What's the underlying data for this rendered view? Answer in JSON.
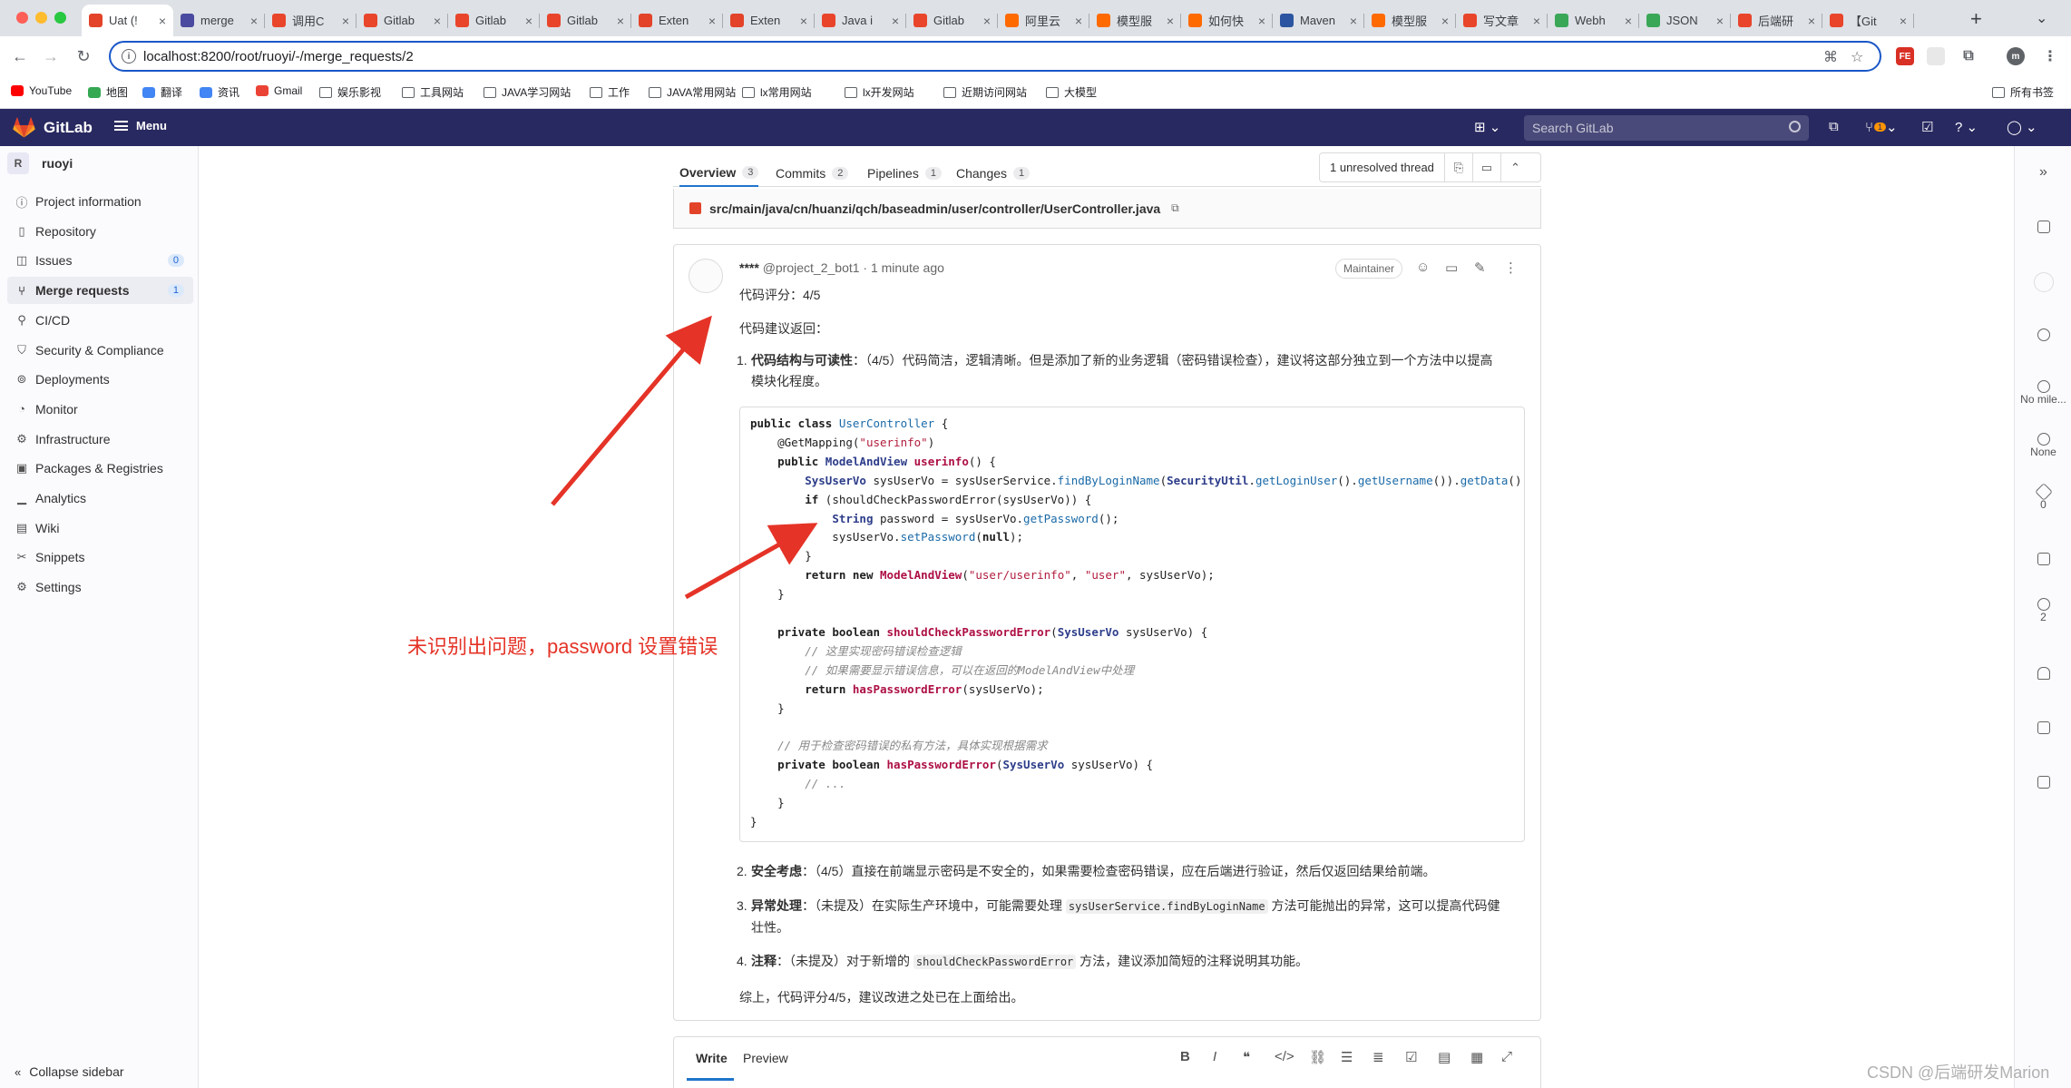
{
  "browser": {
    "tabs": [
      {
        "label": "Uat (!",
        "color": "#e24329",
        "icon": "gitlab-icon",
        "active": true
      },
      {
        "label": "merge",
        "color": "#4a4aa0",
        "icon": "web-icon"
      },
      {
        "label": "调用C",
        "color": "#e8452b",
        "icon": "csdn-icon"
      },
      {
        "label": "Gitlab",
        "color": "#e8452b",
        "icon": "csdn-icon"
      },
      {
        "label": "Gitlab",
        "color": "#e8452b",
        "icon": "csdn-icon"
      },
      {
        "label": "Gitlab",
        "color": "#e8452b",
        "icon": "csdn-icon"
      },
      {
        "label": "Exten",
        "color": "#e24329",
        "icon": "gitlab-icon"
      },
      {
        "label": "Exten",
        "color": "#e24329",
        "icon": "gitlab-icon"
      },
      {
        "label": "Java i",
        "color": "#e8452b",
        "icon": "csdn-icon"
      },
      {
        "label": "Gitlab",
        "color": "#e8452b",
        "icon": "csdn-icon"
      },
      {
        "label": "阿里云",
        "color": "#ff6a00",
        "icon": "aliyun-icon"
      },
      {
        "label": "模型服",
        "color": "#ff6a00",
        "icon": "aliyun-icon"
      },
      {
        "label": "如何快",
        "color": "#ff6a00",
        "icon": "aliyun-icon"
      },
      {
        "label": "Maven",
        "color": "#2b55a0",
        "icon": "maven-icon"
      },
      {
        "label": "模型服",
        "color": "#ff6a00",
        "icon": "aliyun-icon"
      },
      {
        "label": "写文章",
        "color": "#e8452b",
        "icon": "csdn-icon"
      },
      {
        "label": "Webh",
        "color": "#3aa757",
        "icon": "webhook-icon"
      },
      {
        "label": "JSON",
        "color": "#3aa757",
        "icon": "json-icon"
      },
      {
        "label": "后端研",
        "color": "#e8452b",
        "icon": "csdn-icon"
      },
      {
        "label": "【Git",
        "color": "#e8452b",
        "icon": "csdn-icon"
      }
    ],
    "url": "localhost:8200/root/ruoyi/-/merge_requests/2",
    "bookmarks": [
      {
        "label": "YouTube",
        "icon": "youtube-icon"
      },
      {
        "label": "地图",
        "icon": "maps-icon"
      },
      {
        "label": "翻译",
        "icon": "translate-icon"
      },
      {
        "label": "资讯",
        "icon": "news-icon"
      },
      {
        "label": "Gmail",
        "icon": "gmail-icon"
      },
      {
        "label": "娱乐影视",
        "icon": "folder-icon"
      },
      {
        "label": "工具网站",
        "icon": "folder-icon"
      },
      {
        "label": "JAVA学习网站",
        "icon": "folder-icon"
      },
      {
        "label": "工作",
        "icon": "folder-icon"
      },
      {
        "label": "JAVA常用网站",
        "icon": "folder-icon"
      },
      {
        "label": "lx常用网站",
        "icon": "folder-icon"
      },
      {
        "label": "lx开发网站",
        "icon": "folder-icon"
      },
      {
        "label": "近期访问网站",
        "icon": "folder-icon"
      },
      {
        "label": "大模型",
        "icon": "folder-icon"
      }
    ],
    "all_bookmarks": "所有书签"
  },
  "gitlab": {
    "brand": "GitLab",
    "menu": "Menu",
    "search_placeholder": "Search GitLab",
    "mr_badge": "1"
  },
  "sidebar": {
    "project_initial": "R",
    "project_name": "ruoyi",
    "items": [
      {
        "label": "Project information",
        "icon": "info-icon"
      },
      {
        "label": "Repository",
        "icon": "doc-icon"
      },
      {
        "label": "Issues",
        "icon": "issues-icon",
        "count": "0"
      },
      {
        "label": "Merge requests",
        "icon": "merge-request-icon",
        "count": "1",
        "active": true
      },
      {
        "label": "CI/CD",
        "icon": "rocket-icon"
      },
      {
        "label": "Security & Compliance",
        "icon": "shield-icon"
      },
      {
        "label": "Deployments",
        "icon": "deployments-icon"
      },
      {
        "label": "Monitor",
        "icon": "monitor-icon"
      },
      {
        "label": "Infrastructure",
        "icon": "infrastructure-icon"
      },
      {
        "label": "Packages & Registries",
        "icon": "package-icon"
      },
      {
        "label": "Analytics",
        "icon": "chart-icon"
      },
      {
        "label": "Wiki",
        "icon": "book-icon"
      },
      {
        "label": "Snippets",
        "icon": "snippet-icon"
      },
      {
        "label": "Settings",
        "icon": "gear-icon"
      }
    ],
    "collapse": "Collapse sidebar"
  },
  "mr": {
    "tabs": [
      {
        "label": "Overview",
        "count": "3",
        "active": true
      },
      {
        "label": "Commits",
        "count": "2"
      },
      {
        "label": "Pipelines",
        "count": "1"
      },
      {
        "label": "Changes",
        "count": "1"
      }
    ],
    "unresolved": "1 unresolved thread",
    "file_path": "src/main/java/cn/huanzi/qch/baseadmin/user/controller/UserController.java"
  },
  "note": {
    "author": "****",
    "handle": "@project_2_bot1 · 1 minute ago",
    "role": "Maintainer",
    "score": "代码评分：4/5",
    "intro": "代码建议返回：",
    "item1_title": "代码结构与可读性",
    "item1_text": "：（4/5）代码简洁，逻辑清晰。但是添加了新的业务逻辑（密码错误检查），建议将这部分独立到一个方法中以提高",
    "item1_text2": "模块化程度。",
    "item2_title": "安全考虑",
    "item2_text": "：（4/5）直接在前端显示密码是不安全的，如果需要检查密码错误，应在后端进行验证，然后仅返回结果给前端。",
    "item3_title": "异常处理",
    "item3_pre": "：（未提及）在实际生产环境中，可能需要处理 ",
    "item3_code": "sysUserService.findByLoginName",
    "item3_post": " 方法可能抛出的异常，这可以提高代码健",
    "item3_text2": "壮性。",
    "item4_title": "注释",
    "item4_pre": "：（未提及）对于新增的 ",
    "item4_code": "shouldCheckPasswordError",
    "item4_post": " 方法，建议添加简短的注释说明其功能。",
    "summary": "综上，代码评分4/5，建议改进之处已在上面给出。"
  },
  "annotation": "未识别出问题，password 设置错误",
  "sidebar_right": {
    "milestone": "No mile...",
    "time": "None",
    "labels": "0",
    "participants": "2"
  },
  "editor": {
    "write": "Write",
    "preview": "Preview"
  },
  "watermark": "CSDN @后端研发Marion",
  "colors": {
    "nav": "#292961",
    "annotation": "#e53327",
    "accent": "#1f75cb"
  }
}
